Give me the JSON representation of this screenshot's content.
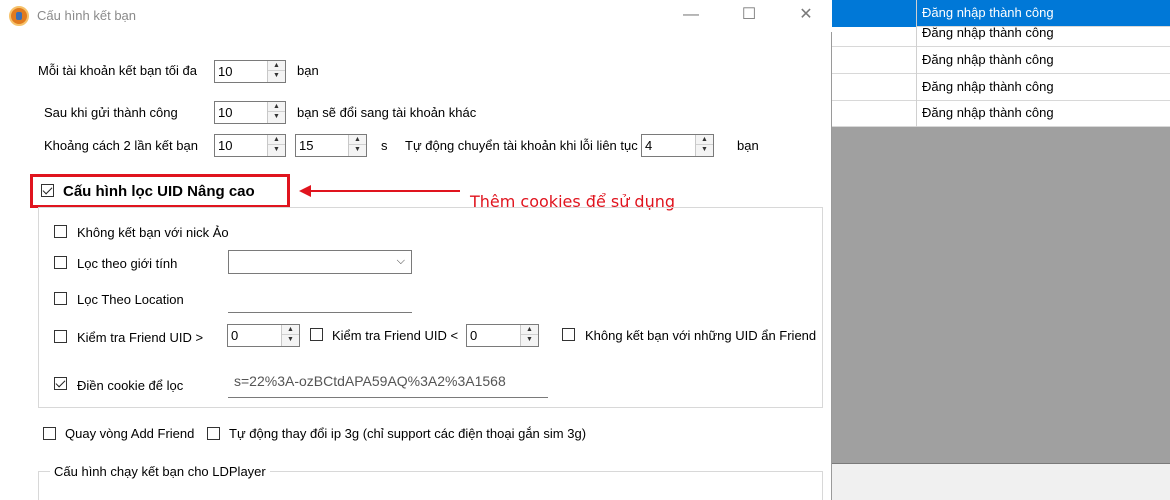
{
  "background_grid": {
    "rows": [
      {
        "status": "Đăng nhập thành công",
        "selected": true
      },
      {
        "status": "Đăng nhập thành công",
        "selected": false
      },
      {
        "status": "Đăng nhập thành công",
        "selected": false
      },
      {
        "status": "Đăng nhập thành công",
        "selected": false
      },
      {
        "status": "Đăng nhập thành công",
        "selected": false
      }
    ]
  },
  "dialog": {
    "title": "Cấu hình kết bạn",
    "minimize": "—",
    "maximize": "☐",
    "close": "✕"
  },
  "settings": {
    "max_friends_label": "Mỗi tài khoản kết bạn tối đa",
    "max_friends_value": "10",
    "max_friends_unit": "bạn",
    "after_sent_label": "Sau khi gửi thành công",
    "after_sent_value": "10",
    "after_sent_unit": "bạn sẽ đổi sang tài khoản khác",
    "interval_label": "Khoảng cách 2 lần kết bạn",
    "interval_min": "10",
    "interval_max": "15",
    "interval_unit": "s",
    "auto_switch_label": "Tự động chuyển tài khoản khi lỗi liên tục",
    "auto_switch_value": "4",
    "auto_switch_unit": "bạn"
  },
  "advanced": {
    "label": "Cấu hình lọc UID Nâng cao",
    "checked": true,
    "annotation": "Thêm cookies để sử dụng",
    "no_fake_label": "Không kết bạn với nick Ảo",
    "gender_label": "Lọc theo giới tính",
    "gender_value": "",
    "location_label": "Lọc Theo Location",
    "friend_gt_label": "Kiểm tra Friend UID >",
    "friend_gt_value": "0",
    "friend_lt_label": "Kiểm tra Friend UID <",
    "friend_lt_value": "0",
    "hidden_friend_label": "Không kết bạn với những UID ẩn Friend",
    "cookie_label": "Điền cookie để lọc",
    "cookie_checked": true,
    "cookie_value": "s=22%3A-ozBCtdAPA59AQ%3A2%3A1568"
  },
  "extras": {
    "rotate_label": "Quay vòng Add Friend",
    "auto_ip_label": "Tự động thay đổi ip 3g (chỉ support các điện thoại gắn sim 3g)",
    "ldplayer_group_label": "Cấu hình chạy kết bạn cho LDPlayer"
  }
}
